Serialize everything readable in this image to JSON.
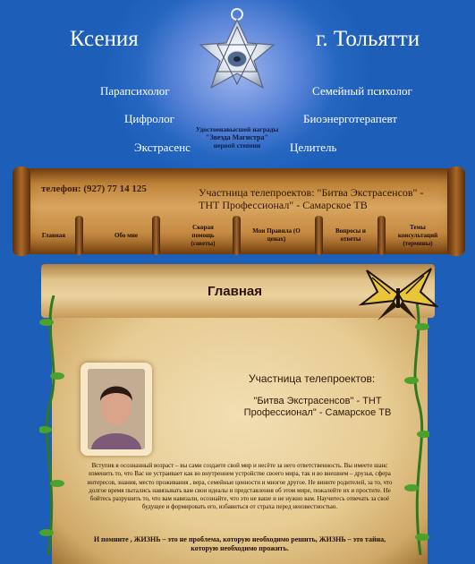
{
  "header": {
    "name": "Ксения",
    "city": "г. Тольятти",
    "roles_left": [
      "Парапсихолог",
      "Цифролог",
      "Экстрасенс"
    ],
    "roles_right": [
      "Семейный психолог",
      "Биоэнерготерапевт",
      "Целитель"
    ],
    "award": {
      "title": "Удостоенавысшей награды",
      "name": "\"Звезда Магистра\"",
      "degree": "первой степени"
    }
  },
  "contact": {
    "phone": "телефон: (927) 77 14 125",
    "tv": "Участница телепроектов: \"Битва Экстрасенсов\" - ТНТ Профессионал\" - Самарское ТВ"
  },
  "nav": {
    "items": [
      {
        "label": "Главная"
      },
      {
        "label": "Обо мне"
      },
      {
        "label": "Скорая помощь (советы)"
      },
      {
        "label": "Мои Правила (О ценах)"
      },
      {
        "label": "Вопросы и ответы"
      },
      {
        "label": "Темы консультаций (термины)"
      }
    ]
  },
  "main": {
    "title": "Главная",
    "tele_heading": "Участница телепроектов:",
    "tele_shows": "\"Битва Экстрасенсов\" - ТНТ Профессионал\" - Самарское ТВ",
    "paragraph": "Вступив в осознанный возраст – вы сами создаете свой мир и несёте за него ответственность. Вы имеете шанс изменить то, что Вас не устраивает как во внутреннем устройстве своего мира, так и во внешнем – друзья, сфера интересов, знания, место проживания , вера, семейные ценности и многое другое. Не вините родителей, за то, что долгое время пытались навязывать вам свои идеалы и представления об этом мире, пожалейте их и простите. Не бойтесь разрушить то, что вам навязали, осознайте, что это не ваше и не нужно вам. Научитесь отвечать за своё будущее и формировать его, избавиться от страха перед неизвестностью.",
    "final": "И помните , ЖИЗНЬ – это не проблема, которую необходимо решить, ЖИЗНЬ – это тайна, которую необходимо прожить."
  }
}
